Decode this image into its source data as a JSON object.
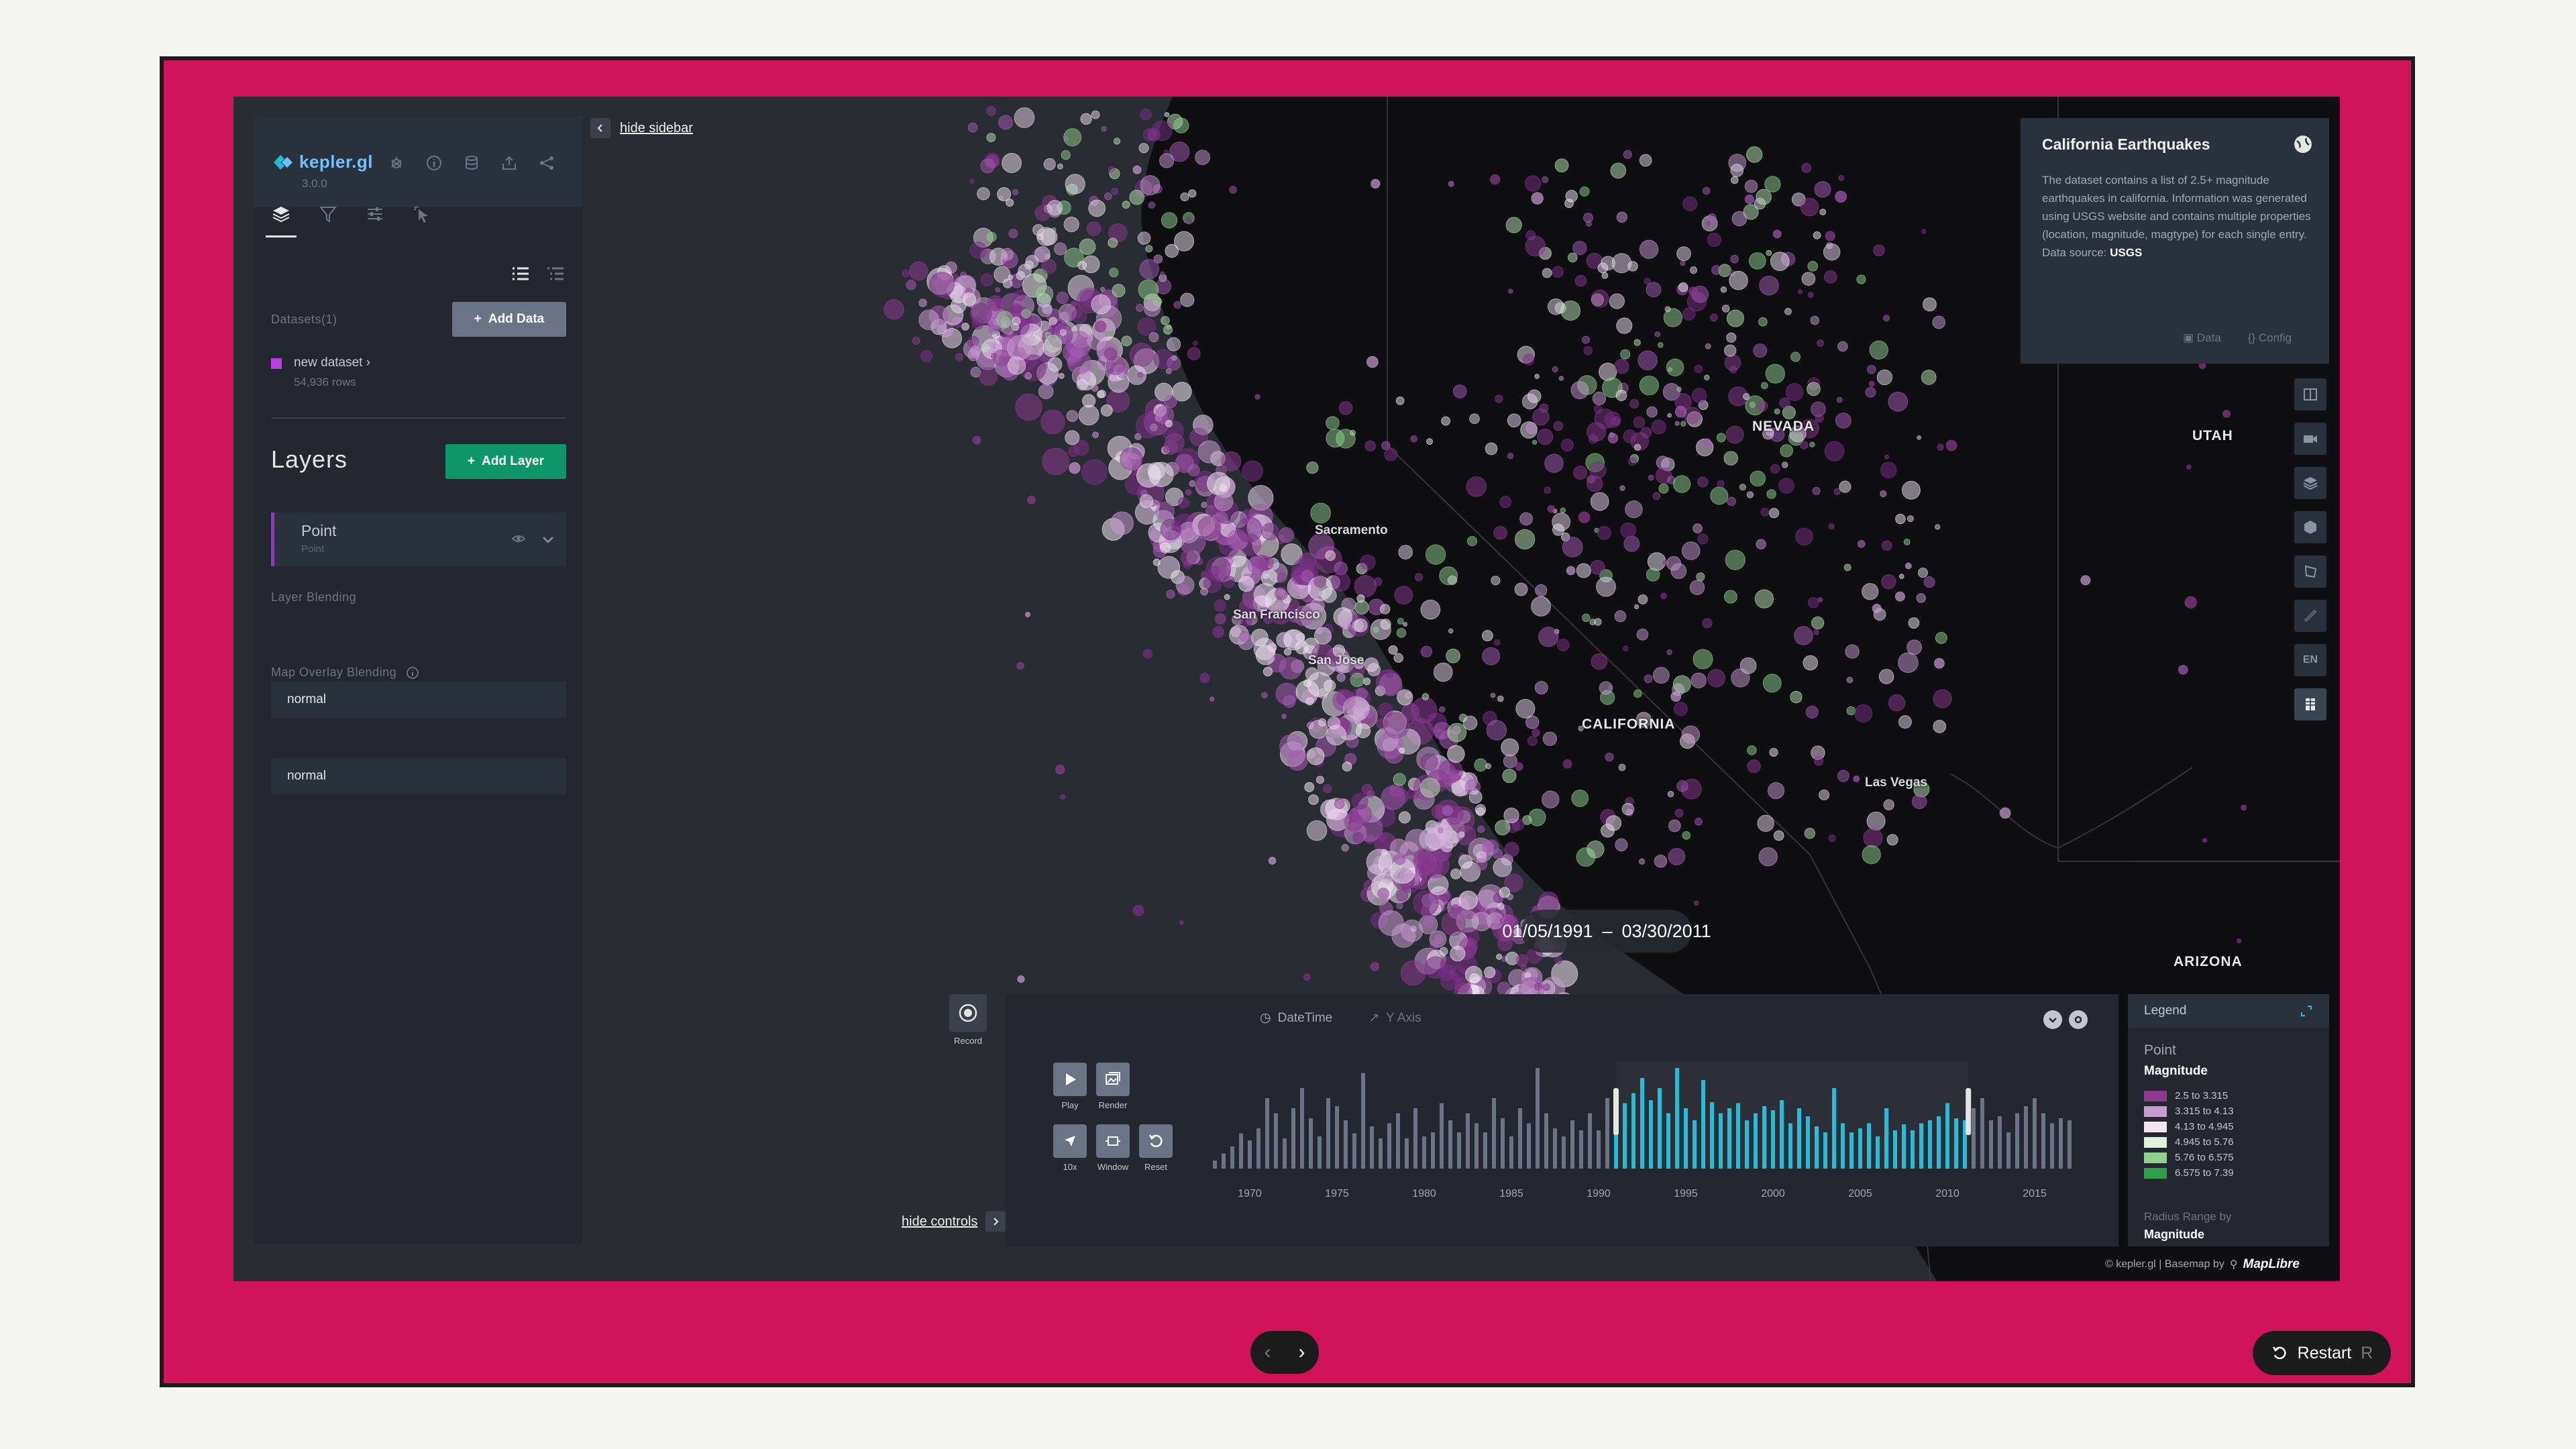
{
  "app": {
    "logo_text": "kepler.gl",
    "version": "3.0.0"
  },
  "sidebar": {
    "datasets_label": "Datasets(1)",
    "add_data_label": "Add Data",
    "dataset": {
      "name": "new dataset",
      "rows": "54,936 rows",
      "color": "#b83ee0"
    },
    "layers_title": "Layers",
    "add_layer_label": "Add Layer",
    "layer": {
      "name": "Point",
      "type": "Point"
    },
    "layer_blending_label": "Layer Blending",
    "layer_blending_value": "normal",
    "overlay_blending_label": "Map Overlay Blending",
    "overlay_blending_value": "normal",
    "hide_sidebar_label": "hide sidebar"
  },
  "info_panel": {
    "title": "California Earthquakes",
    "description": "The dataset contains a list of 2.5+ magnitude earthquakes in california. Information was generated using USGS website and contains multiple properties (location, magnitude, magtype) for each single entry. Data source:",
    "source": "USGS",
    "data_link": "Data",
    "config_link": "Config"
  },
  "map": {
    "region_labels": [
      "NEVADA",
      "UTAH",
      "CALIFORNIA",
      "ARIZONA"
    ],
    "city_labels": [
      "Sacramento",
      "San Francisco",
      "San Jose",
      "Las Vegas"
    ],
    "map_control_lang": "EN"
  },
  "time_filter": {
    "start": "01/05/1991",
    "separator": "–",
    "end": "03/30/2011",
    "record_label": "Record",
    "tab_datetime": "DateTime",
    "tab_yaxis": "Y Axis",
    "play_label": "Play",
    "render_label": "Render",
    "speed_label": "10x",
    "window_label": "Window",
    "reset_label": "Reset",
    "hide_controls_label": "hide controls",
    "year_ticks": [
      "1970",
      "1975",
      "1980",
      "1985",
      "1990",
      "1995",
      "2000",
      "2005",
      "2010",
      "2015"
    ]
  },
  "chart_data": {
    "type": "bar",
    "xlabel": "",
    "ylabel": "",
    "x_range": [
      1967.5,
      2017.5
    ],
    "selected_range": [
      1991.0,
      2011.2
    ],
    "colors": {
      "inside": "#1fbad6",
      "outside": "#6a7485"
    },
    "x": [
      1968.0,
      1968.5,
      1969.0,
      1969.5,
      1970.0,
      1970.5,
      1971.0,
      1971.5,
      1972.0,
      1972.5,
      1973.0,
      1973.5,
      1974.0,
      1974.5,
      1975.0,
      1975.5,
      1976.0,
      1976.5,
      1977.0,
      1977.5,
      1978.0,
      1978.5,
      1979.0,
      1979.5,
      1980.0,
      1980.5,
      1981.0,
      1981.5,
      1982.0,
      1982.5,
      1983.0,
      1983.5,
      1984.0,
      1984.5,
      1985.0,
      1985.5,
      1986.0,
      1986.5,
      1987.0,
      1987.5,
      1988.0,
      1988.5,
      1989.0,
      1989.5,
      1990.0,
      1990.5,
      1991.0,
      1991.5,
      1992.0,
      1992.5,
      1993.0,
      1993.5,
      1994.0,
      1994.5,
      1995.0,
      1995.5,
      1996.0,
      1996.5,
      1997.0,
      1997.5,
      1998.0,
      1998.5,
      1999.0,
      1999.5,
      2000.0,
      2000.5,
      2001.0,
      2001.5,
      2002.0,
      2002.5,
      2003.0,
      2003.5,
      2004.0,
      2004.5,
      2005.0,
      2005.5,
      2006.0,
      2006.5,
      2007.0,
      2007.5,
      2008.0,
      2008.5,
      2009.0,
      2009.5,
      2010.0,
      2010.5,
      2011.0,
      2011.5,
      2012.0,
      2012.5,
      2013.0,
      2013.5,
      2014.0,
      2014.5,
      2015.0,
      2015.5,
      2016.0,
      2016.5,
      2017.0
    ],
    "values": [
      8,
      15,
      22,
      35,
      28,
      40,
      70,
      55,
      30,
      60,
      80,
      50,
      32,
      70,
      62,
      48,
      35,
      95,
      42,
      30,
      45,
      55,
      30,
      60,
      32,
      36,
      65,
      48,
      36,
      55,
      45,
      36,
      70,
      50,
      32,
      60,
      45,
      100,
      55,
      40,
      32,
      48,
      38,
      55,
      38,
      70,
      48,
      65,
      75,
      90,
      68,
      80,
      55,
      100,
      60,
      48,
      88,
      66,
      55,
      60,
      65,
      48,
      55,
      62,
      58,
      68,
      45,
      60,
      52,
      42,
      36,
      80,
      45,
      36,
      40,
      45,
      32,
      60,
      38,
      44,
      38,
      45,
      48,
      52,
      65,
      50,
      48,
      60,
      70,
      48,
      52,
      36,
      55,
      62,
      70,
      55,
      45,
      50,
      48
    ],
    "year_ticks": [
      1970,
      1975,
      1980,
      1985,
      1990,
      1995,
      2000,
      2005,
      2010,
      2015
    ]
  },
  "legend": {
    "title": "Legend",
    "layer_name": "Point",
    "field": "Magnitude",
    "items": [
      {
        "label": "2.5 to 3.315",
        "color": "#8b3a8f"
      },
      {
        "label": "3.315 to 4.13",
        "color": "#c79ad0"
      },
      {
        "label": "4.13 to 4.945",
        "color": "#f1e6f2"
      },
      {
        "label": "4.945 to 5.76",
        "color": "#dff1da"
      },
      {
        "label": "5.76 to 6.575",
        "color": "#8fd18d"
      },
      {
        "label": "6.575 to 7.39",
        "color": "#2e9e4a"
      }
    ],
    "radius_label": "Radius Range by",
    "radius_field": "Magnitude"
  },
  "attribution": {
    "text": "© kepler.gl | Basemap by",
    "brand": "MapLibre"
  },
  "presentation": {
    "restart_label": "Restart",
    "restart_key": "R",
    "prev_icon": "‹",
    "next_icon": "›"
  }
}
